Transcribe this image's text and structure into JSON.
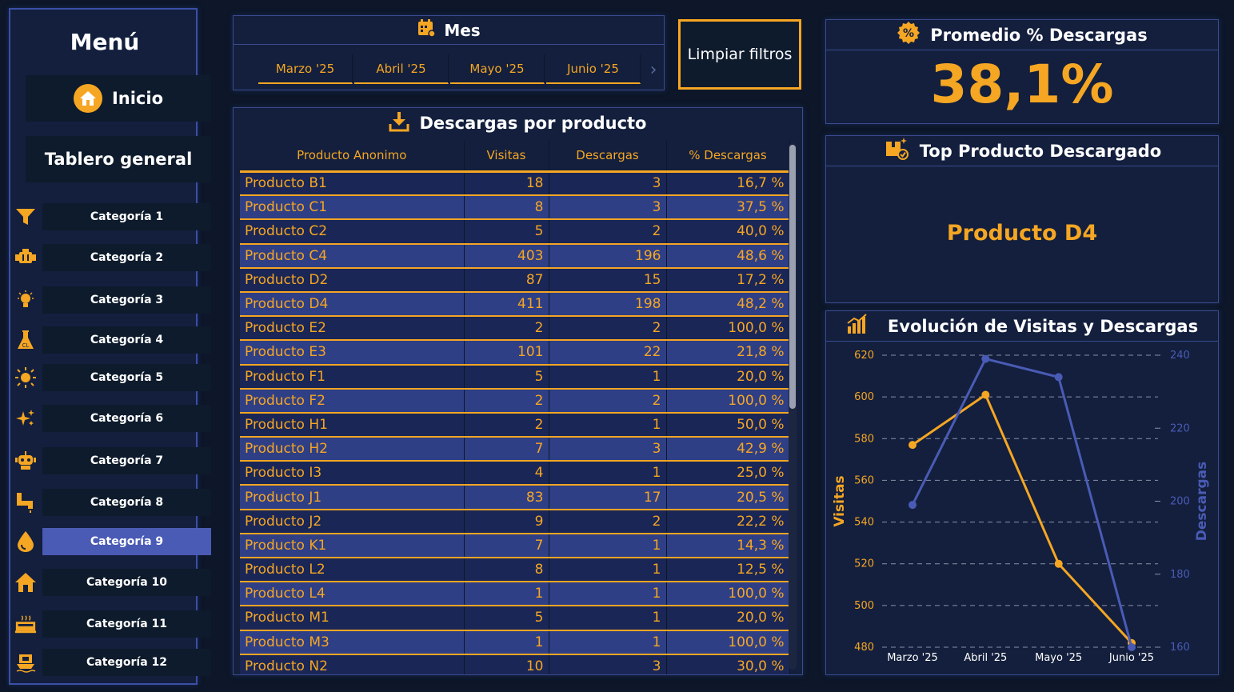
{
  "sidebar": {
    "title": "Menú",
    "home_label": "Inicio",
    "dashboard_label": "Tablero general",
    "categories": [
      {
        "label": "Categoría 1",
        "icon": "funnel-icon"
      },
      {
        "label": "Categoría 2",
        "icon": "engine-icon"
      },
      {
        "label": "Categoría 3",
        "icon": "bulb-icon"
      },
      {
        "label": "Categoría 4",
        "icon": "flask-icon"
      },
      {
        "label": "Categoría 5",
        "icon": "sun-icon"
      },
      {
        "label": "Categoría 6",
        "icon": "sparkle-icon"
      },
      {
        "label": "Categoría 7",
        "icon": "robot-icon"
      },
      {
        "label": "Categoría 8",
        "icon": "pipe-icon"
      },
      {
        "label": "Categoría 9",
        "icon": "drop-icon",
        "active": true
      },
      {
        "label": "Categoría 10",
        "icon": "house-icon"
      },
      {
        "label": "Categoría 11",
        "icon": "factory-icon"
      },
      {
        "label": "Categoría 12",
        "icon": "ship-icon"
      }
    ]
  },
  "month_slicer": {
    "title": "Mes",
    "months": [
      "Marzo '25",
      "Abril '25",
      "Mayo '25",
      "Junio '25"
    ]
  },
  "clear_filters_label": "Limpiar filtros",
  "table": {
    "title": "Descargas por producto",
    "columns": [
      "Producto Anonimo",
      "Visitas",
      "Descargas",
      "% Descargas"
    ],
    "rows": [
      [
        "Producto B1",
        "18",
        "3",
        "16,7 %"
      ],
      [
        "Producto C1",
        "8",
        "3",
        "37,5 %"
      ],
      [
        "Producto C2",
        "5",
        "2",
        "40,0 %"
      ],
      [
        "Producto C4",
        "403",
        "196",
        "48,6 %"
      ],
      [
        "Producto D2",
        "87",
        "15",
        "17,2 %"
      ],
      [
        "Producto D4",
        "411",
        "198",
        "48,2 %"
      ],
      [
        "Producto E2",
        "2",
        "2",
        "100,0 %"
      ],
      [
        "Producto E3",
        "101",
        "22",
        "21,8 %"
      ],
      [
        "Producto F1",
        "5",
        "1",
        "20,0 %"
      ],
      [
        "Producto F2",
        "2",
        "2",
        "100,0 %"
      ],
      [
        "Producto H1",
        "2",
        "1",
        "50,0 %"
      ],
      [
        "Producto H2",
        "7",
        "3",
        "42,9 %"
      ],
      [
        "Producto I3",
        "4",
        "1",
        "25,0 %"
      ],
      [
        "Producto J1",
        "83",
        "17",
        "20,5 %"
      ],
      [
        "Producto J2",
        "9",
        "2",
        "22,2 %"
      ],
      [
        "Producto K1",
        "7",
        "1",
        "14,3 %"
      ],
      [
        "Producto L2",
        "8",
        "1",
        "12,5 %"
      ],
      [
        "Producto L4",
        "1",
        "1",
        "100,0 %"
      ],
      [
        "Producto M1",
        "5",
        "1",
        "20,0 %"
      ],
      [
        "Producto M3",
        "1",
        "1",
        "100,0 %"
      ],
      [
        "Producto N2",
        "10",
        "3",
        "30,0 %"
      ]
    ]
  },
  "kpi": {
    "title": "Promedio % Descargas",
    "value": "38,1%"
  },
  "top_product": {
    "title": "Top Producto Descargado",
    "value": "Producto D4"
  },
  "colors": {
    "accent": "#f5a623",
    "secondary": "#4a5bb5",
    "background": "#0d1729",
    "panel": "#131f3d"
  },
  "chart_data": {
    "type": "line",
    "title": "Evolución de Visitas y Descargas",
    "categories": [
      "Marzo '25",
      "Abril '25",
      "Mayo '25",
      "Junio '25"
    ],
    "series": [
      {
        "name": "Visitas",
        "axis": "left",
        "color": "#f5a623",
        "values": [
          577,
          601,
          520,
          482
        ]
      },
      {
        "name": "Descargas",
        "axis": "right",
        "color": "#4a5bb5",
        "values": [
          199,
          239,
          234,
          160
        ]
      }
    ],
    "ylabel": "Visitas",
    "y2label": "Descargas",
    "ylim": [
      480,
      620
    ],
    "y_ticks": [
      480,
      500,
      520,
      540,
      560,
      580,
      600,
      620
    ],
    "y2lim": [
      160,
      240
    ],
    "y2_ticks": [
      160,
      180,
      200,
      220,
      240
    ],
    "grid": true
  }
}
